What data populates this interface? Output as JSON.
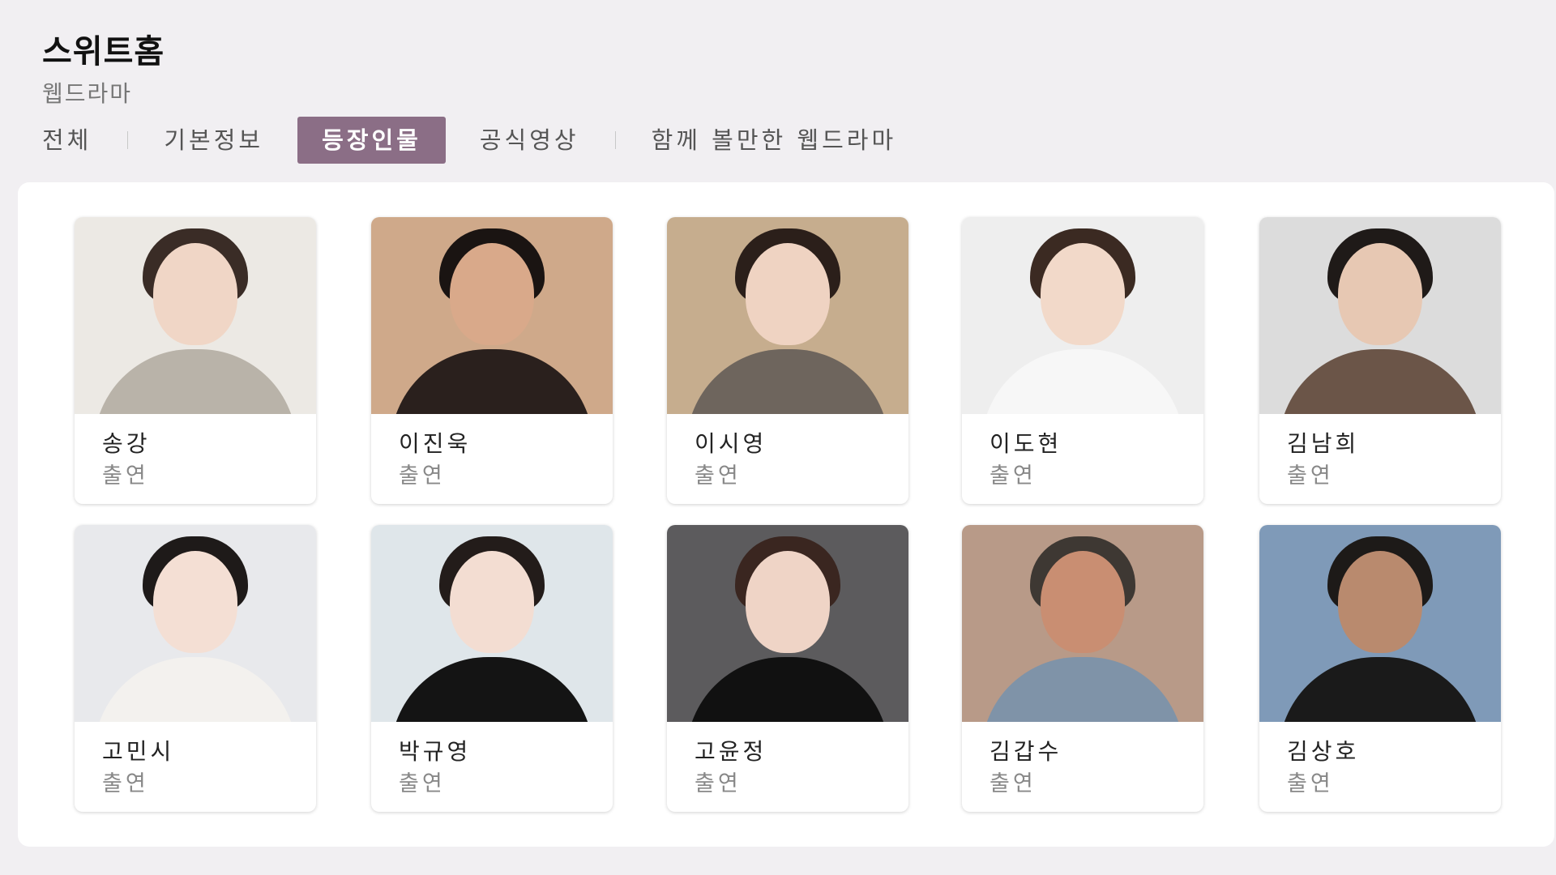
{
  "header": {
    "title": "스위트홈",
    "subtitle": "웹드라마"
  },
  "tabs": [
    {
      "label": "전체",
      "active": false
    },
    {
      "label": "기본정보",
      "active": false
    },
    {
      "label": "등장인물",
      "active": true
    },
    {
      "label": "공식영상",
      "active": false
    },
    {
      "label": "함께 볼만한 웹드라마",
      "active": false
    }
  ],
  "colors": {
    "accent": "#8b6e86",
    "page_bg": "#f1eff2"
  },
  "cast": [
    {
      "name": "송강",
      "role": "출연",
      "photo": {
        "bg": "#ece9e4",
        "hair": "#3a2c26",
        "skin": "#f0d6c6",
        "body": "#b9b3a9"
      }
    },
    {
      "name": "이진욱",
      "role": "출연",
      "photo": {
        "bg": "#cfa98a",
        "hair": "#1a1412",
        "skin": "#d9a98a",
        "body": "#2a201d"
      }
    },
    {
      "name": "이시영",
      "role": "출연",
      "photo": {
        "bg": "#c6ad8e",
        "hair": "#2b1f1a",
        "skin": "#efd3c2",
        "body": "#6e655d"
      }
    },
    {
      "name": "이도현",
      "role": "출연",
      "photo": {
        "bg": "#eeeeee",
        "hair": "#3b2a22",
        "skin": "#f2d9c9",
        "body": "#f7f7f7"
      }
    },
    {
      "name": "김남희",
      "role": "출연",
      "photo": {
        "bg": "#dcdcdc",
        "hair": "#1f1a18",
        "skin": "#e7c8b3",
        "body": "#6b5548"
      }
    },
    {
      "name": "고민시",
      "role": "출연",
      "photo": {
        "bg": "#e8e9ec",
        "hair": "#1e1a19",
        "skin": "#f4dfd4",
        "body": "#f3f1ee"
      }
    },
    {
      "name": "박규영",
      "role": "출연",
      "photo": {
        "bg": "#dfe6ea",
        "hair": "#231c1a",
        "skin": "#f3ddd2",
        "body": "#141414"
      }
    },
    {
      "name": "고윤정",
      "role": "출연",
      "photo": {
        "bg": "#5c5b5d",
        "hair": "#3a2620",
        "skin": "#efd4c6",
        "body": "#111111"
      }
    },
    {
      "name": "김갑수",
      "role": "출연",
      "photo": {
        "bg": "#b89a88",
        "hair": "#3e3833",
        "skin": "#c98e72",
        "body": "#7f93a8"
      }
    },
    {
      "name": "김상호",
      "role": "출연",
      "photo": {
        "bg": "#7f9ab8",
        "hair": "#1d1a18",
        "skin": "#b98a6e",
        "body": "#1a1a1a"
      }
    }
  ]
}
